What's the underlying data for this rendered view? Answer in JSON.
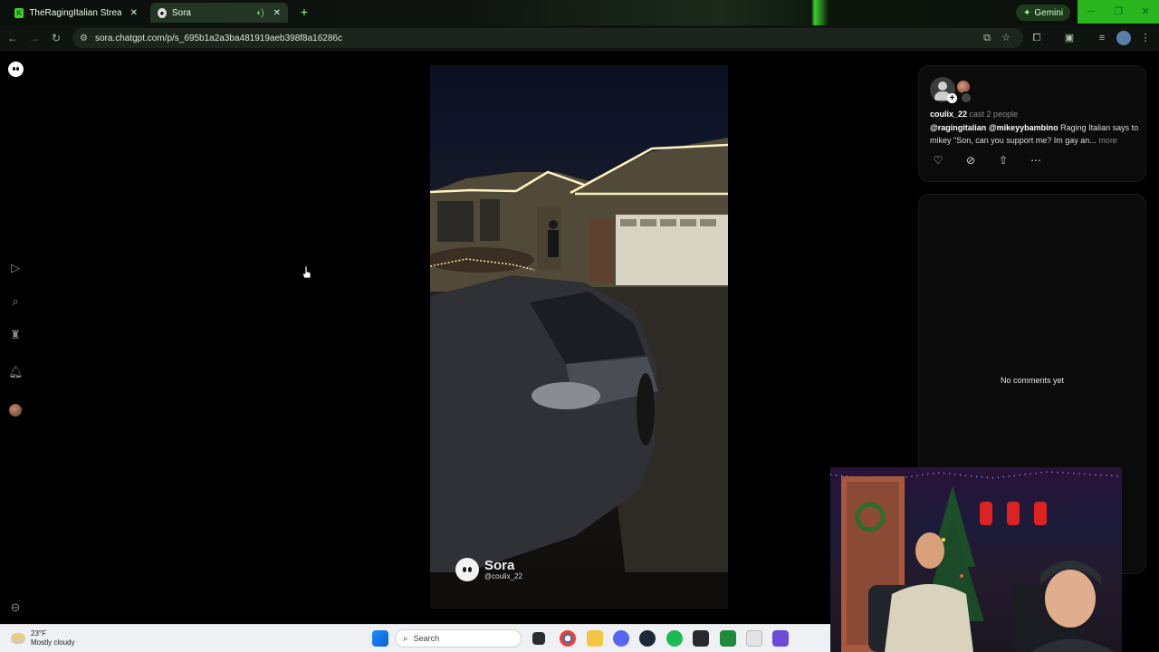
{
  "browser": {
    "tabs": [
      {
        "title": "TheRagingItalian Stream - Wat",
        "favicon": "K"
      },
      {
        "title": "Sora",
        "favicon": "S"
      }
    ],
    "address": "sora.chatgpt.com/p/s_695b1a2a3ba481919aeb398f8a16286c",
    "gemini_label": "Gemini"
  },
  "post": {
    "username": "coulix_22",
    "cast_text": "cast 2 people",
    "mention1": "@ragingitalian",
    "mention2": "@mikeyybambino",
    "caption": "Raging Italian says to mikey \"Son, can you support me? Im gay an...",
    "more": "more"
  },
  "comments": {
    "empty_text": "No comments yet"
  },
  "watermark": {
    "brand": "Sora",
    "handle": "@coulix_22"
  },
  "taskbar": {
    "temperature": "23°F",
    "condition": "Mostly cloudy",
    "search_label": "Search"
  },
  "icons": {
    "rail": [
      "sora-logo-icon",
      "video-icon",
      "search-icon",
      "trophy-icon",
      "bell-icon",
      "avatar",
      "more-icon"
    ],
    "post_actions": [
      "heart-icon",
      "remix-icon",
      "share-icon",
      "more-icon"
    ]
  }
}
